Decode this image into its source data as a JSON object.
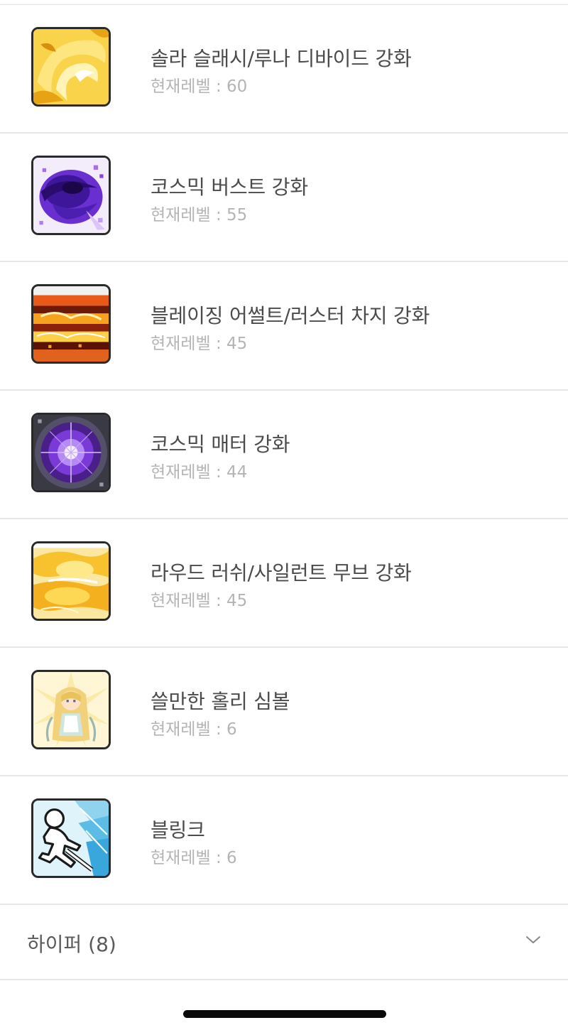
{
  "skills": [
    {
      "name": "솔라 슬래시/루나 디바이드 강화",
      "level": "현재레벨 : 60",
      "icon": "solar-slash-icon"
    },
    {
      "name": "코스믹 버스트 강화",
      "level": "현재레벨 : 55",
      "icon": "cosmic-burst-icon"
    },
    {
      "name": "블레이징 어썰트/러스터 차지 강화",
      "level": "현재레벨 : 45",
      "icon": "blazing-assault-icon"
    },
    {
      "name": "코스믹 매터 강화",
      "level": "현재레벨 : 44",
      "icon": "cosmic-matter-icon"
    },
    {
      "name": "라우드 러쉬/사일런트 무브 강화",
      "level": "현재레벨 : 45",
      "icon": "loud-rush-icon"
    },
    {
      "name": "쓸만한 홀리 심볼",
      "level": "현재레벨 : 6",
      "icon": "holy-symbol-icon"
    },
    {
      "name": "블링크",
      "level": "현재레벨 : 6",
      "icon": "blink-icon"
    }
  ],
  "section": {
    "title": "하이퍼 (8)",
    "toggle_icon": "chevron-down-icon"
  },
  "colors": {
    "divider": "#e6e6e6",
    "name_text": "#4b4b4b",
    "level_text": "#b4b4b4"
  }
}
